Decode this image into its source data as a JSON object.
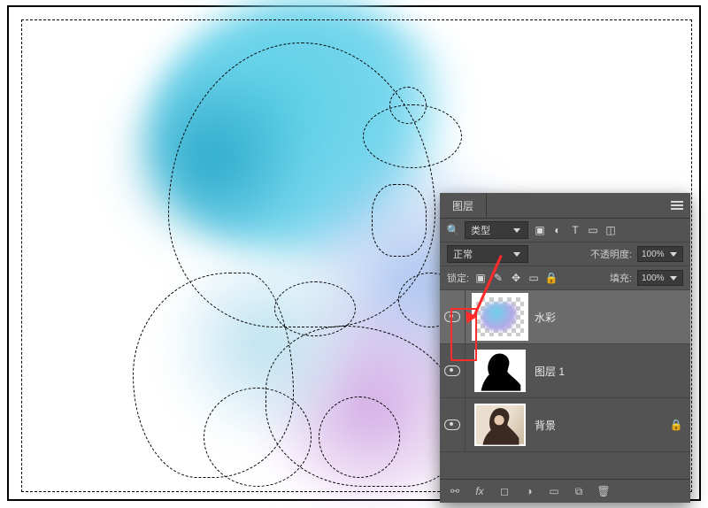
{
  "panel": {
    "tab_label": "图层",
    "filter_kind_label": "类型",
    "blend_mode": "正常",
    "opacity_label": "不透明度:",
    "opacity_value": "100%",
    "lock_label": "锁定:",
    "fill_label": "填充:",
    "fill_value": "100%"
  },
  "filter_icons": [
    "image-filter-icon",
    "adjustment-filter-icon",
    "type-filter-icon",
    "shape-filter-icon",
    "smart-filter-icon"
  ],
  "lock_icons": [
    "lock-transparent-icon",
    "lock-image-icon",
    "lock-position-icon",
    "lock-artboard-icon",
    "lock-all-icon"
  ],
  "layers": [
    {
      "name": "水彩",
      "visible": true,
      "active": true,
      "thumb": "watercolor",
      "locked": false
    },
    {
      "name": "图层 1",
      "visible": true,
      "active": false,
      "thumb": "silhouette",
      "locked": false
    },
    {
      "name": "背景",
      "visible": true,
      "active": false,
      "thumb": "photo",
      "locked": true
    }
  ],
  "footer_icons": [
    "link-layers-icon",
    "layer-fx-icon",
    "layer-mask-icon",
    "adjustment-layer-icon",
    "group-icon",
    "new-layer-icon",
    "delete-layer-icon"
  ],
  "glyph": {
    "search": "🔍",
    "image": "▣",
    "adjust": "◐",
    "type": "T",
    "shape": "▭",
    "smart": "◫",
    "brush": "✎",
    "move": "✥",
    "artboard": "�떷",
    "lock": "🔒",
    "link": "⚯",
    "fx": "fx",
    "mask": "◻",
    "circle": "◑",
    "folder": "▭",
    "new": "⧉",
    "trash": "🗑"
  }
}
